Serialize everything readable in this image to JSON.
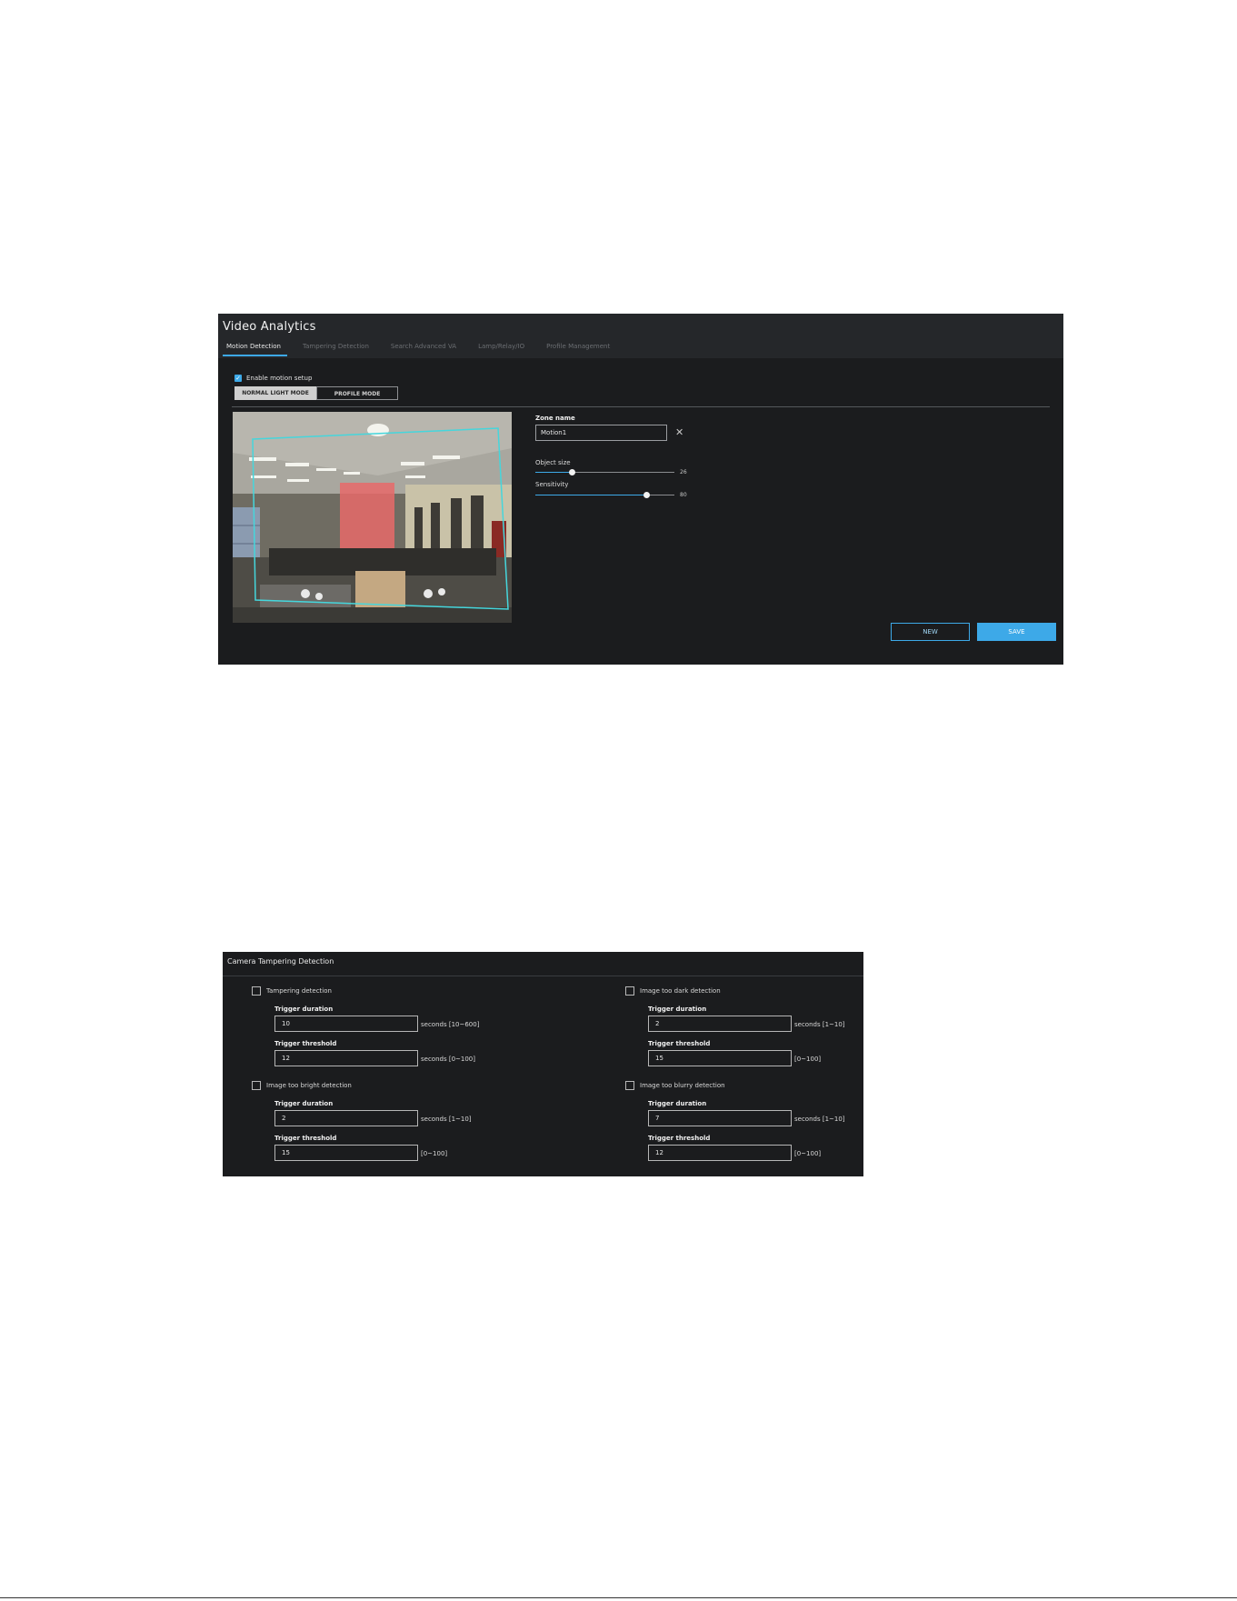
{
  "video_analytics": {
    "title": "Video Analytics",
    "tabs": [
      {
        "label": "Motion Detection",
        "active": true
      },
      {
        "label": "Tampering Detection",
        "active": false
      },
      {
        "label": "Search Advanced VA",
        "active": false
      },
      {
        "label": "Lamp/Relay/IO",
        "active": false
      },
      {
        "label": "Profile Management",
        "active": false
      }
    ],
    "enable_label": "Enable motion setup",
    "enable_checked": true,
    "modes": [
      "NORMAL LIGHT MODE",
      "PROFILE MODE"
    ],
    "active_mode": "NORMAL LIGHT MODE",
    "zone_name_label": "Zone name",
    "zone_name_value": "Motion1",
    "object_size": {
      "label": "Object size",
      "value": 26,
      "max": 100
    },
    "sensitivity": {
      "label": "Sensitivity",
      "value": 80,
      "max": 100
    },
    "new_label": "NEW",
    "save_label": "SAVE",
    "accent_color": "#3da9e8",
    "zone_outline_color": "#45d6dc",
    "zone_fill_color": "#e86a6a"
  },
  "camera_tampering": {
    "title": "Camera Tampering Detection",
    "groups": [
      {
        "name": "Tampering detection",
        "checked": false,
        "duration_label": "Trigger duration",
        "duration_value": "10",
        "duration_range": "seconds [10~600]",
        "threshold_label": "Trigger threshold",
        "threshold_value": "12",
        "threshold_range": "seconds [0~100]"
      },
      {
        "name": "Image too dark detection",
        "checked": false,
        "duration_label": "Trigger duration",
        "duration_value": "2",
        "duration_range": "seconds [1~10]",
        "threshold_label": "Trigger threshold",
        "threshold_value": "15",
        "threshold_range": "[0~100]"
      },
      {
        "name": "Image too bright detection",
        "checked": false,
        "duration_label": "Trigger duration",
        "duration_value": "2",
        "duration_range": "seconds [1~10]",
        "threshold_label": "Trigger threshold",
        "threshold_value": "15",
        "threshold_range": "[0~100]"
      },
      {
        "name": "Image too blurry detection",
        "checked": false,
        "duration_label": "Trigger duration",
        "duration_value": "7",
        "duration_range": "seconds [1~10]",
        "threshold_label": "Trigger threshold",
        "threshold_value": "12",
        "threshold_range": "[0~100]"
      }
    ]
  }
}
